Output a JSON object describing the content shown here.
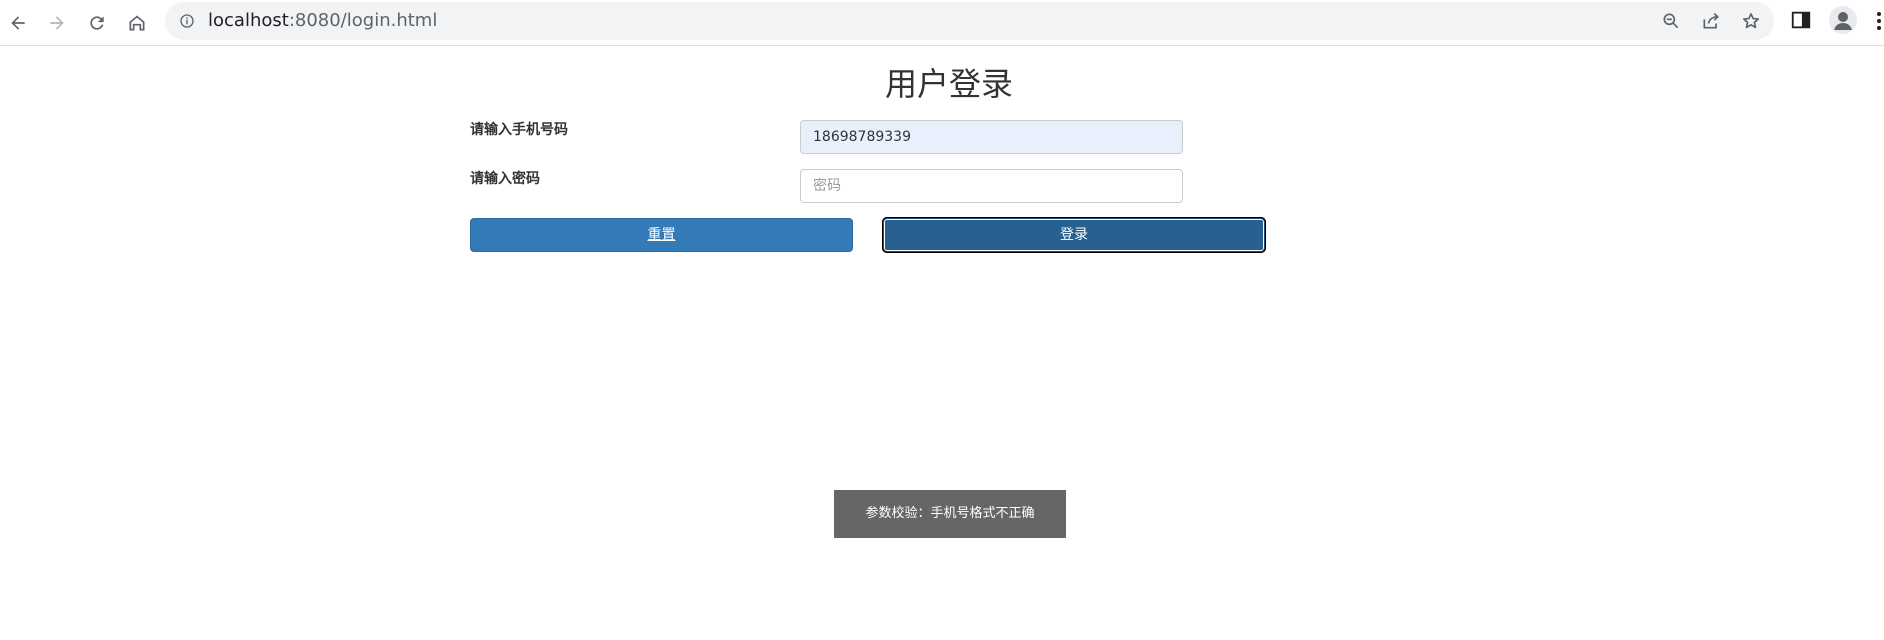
{
  "browser": {
    "url_host": "localhost",
    "url_rest": ":8080/login.html"
  },
  "page": {
    "title": "用户登录"
  },
  "form": {
    "phone_label": "请输入手机号码",
    "phone_value": "18698789339",
    "password_label": "请输入密码",
    "password_placeholder": "密码",
    "reset_label": "重置",
    "login_label": "登录"
  },
  "toast": {
    "message": "参数校验：手机号格式不正确"
  },
  "colors": {
    "primary": "#337ab7",
    "primary_active": "#286090",
    "autofill_bg": "#e8f0fe",
    "toast_bg": "#666666"
  }
}
